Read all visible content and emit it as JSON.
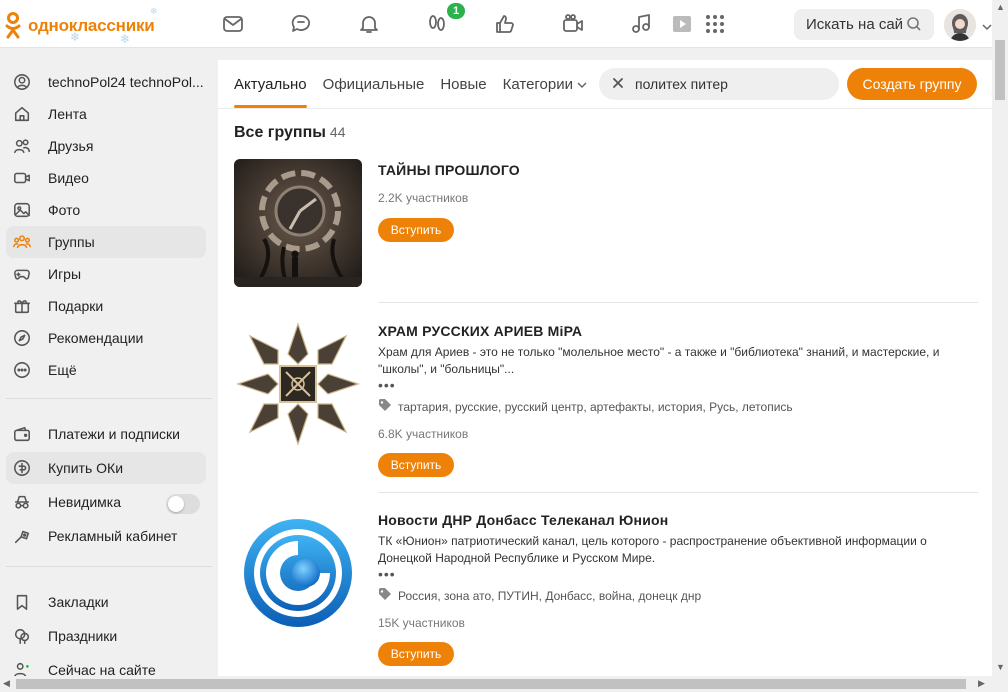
{
  "header": {
    "logo_text": "одноклассники",
    "search_placeholder": "Искать на сайте",
    "badge_count": "1",
    "nav_icons": [
      "mail-icon",
      "discussions-icon",
      "notifications-icon",
      "guests-icon",
      "likes-icon",
      "video-calls-icon",
      "music-icon",
      "video-icon",
      "apps-icon"
    ]
  },
  "sidebar": {
    "items": [
      {
        "label": "technoPol24 technoPol...",
        "icon": "profile-icon"
      },
      {
        "label": "Лента",
        "icon": "home-icon"
      },
      {
        "label": "Друзья",
        "icon": "friends-icon"
      },
      {
        "label": "Видео",
        "icon": "video-icon"
      },
      {
        "label": "Фото",
        "icon": "photo-icon"
      },
      {
        "label": "Группы",
        "icon": "groups-icon"
      },
      {
        "label": "Игры",
        "icon": "games-icon"
      },
      {
        "label": "Подарки",
        "icon": "gift-icon"
      },
      {
        "label": "Рекомендации",
        "icon": "compass-icon"
      },
      {
        "label": "Ещё",
        "icon": "more-icon"
      },
      {
        "label": "Платежи и подписки",
        "icon": "wallet-icon"
      },
      {
        "label": "Купить ОКи",
        "icon": "coin-icon"
      },
      {
        "label": "Невидимка",
        "icon": "incognito-icon"
      },
      {
        "label": "Рекламный кабинет",
        "icon": "ads-icon"
      },
      {
        "label": "Закладки",
        "icon": "bookmark-icon"
      },
      {
        "label": "Праздники",
        "icon": "holidays-icon"
      },
      {
        "label": "Сейчас на сайте",
        "icon": "online-icon"
      }
    ]
  },
  "main": {
    "tabs": [
      "Актуально",
      "Официальные",
      "Новые",
      "Категории"
    ],
    "search_value": "политех питер",
    "create_button": "Создать группу",
    "all_title": "Все группы",
    "all_count": "44",
    "join_label": "Вступить",
    "groups": [
      {
        "name": "ТАЙНЫ ПРОШЛОГО",
        "members": "2.2K участников"
      },
      {
        "name": "ХРАМ РУССКИХ АРИЕВ МiРА",
        "desc": "Храм для Ариев - это не только \"молельное место\" - а также и \"библиотека\" знаний, и мастерские, и \"школы\", и \"больницы\"...",
        "more": "•••",
        "tags": "тартария, русские, русский центр, артефакты, история, Русь, летопись",
        "members": "6.8K участников"
      },
      {
        "name": "Новости ДНР Донбасс Телеканал Юнион",
        "desc": "ТК «Юнион» патриотический канал, цель которого - распространение объективной информации о Донецкой Народной Республике и Русском Мире.",
        "more": "•••",
        "tags": "Россия, зона ато, ПУТИН, Донбасс, война, донецк днр",
        "members": "15K участников"
      }
    ]
  },
  "colors": {
    "accent": "#ee8208",
    "badge": "#2bb24c"
  }
}
